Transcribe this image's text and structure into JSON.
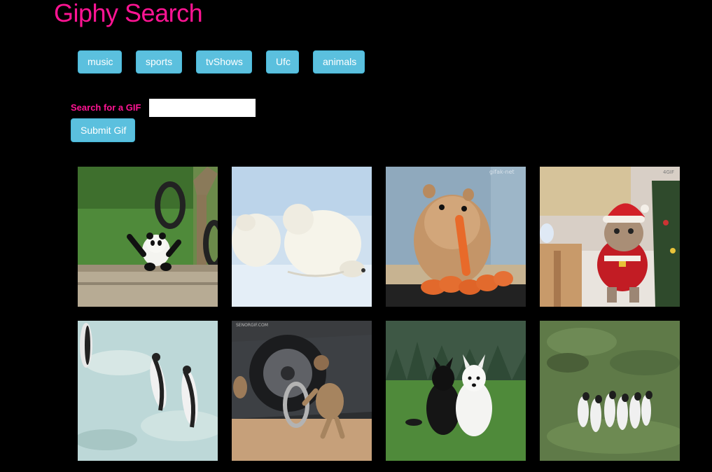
{
  "header": {
    "title": "Giphy Search"
  },
  "categories": [
    "music",
    "sports",
    "tvShows",
    "Ufc",
    "animals"
  ],
  "search": {
    "label": "Search for a GIF",
    "value": "",
    "submit_label": "Submit Gif"
  },
  "gifs": [
    {
      "depicts": "panda-on-log"
    },
    {
      "depicts": "polar-bears-in-snow"
    },
    {
      "depicts": "hamster-eating-carrots",
      "watermark": "gifak-net"
    },
    {
      "depicts": "cat-in-santa-suit",
      "watermark": "4GIF"
    },
    {
      "depicts": "penguins-sliding-on-snow"
    },
    {
      "depicts": "monkey-taking-car-wheel",
      "watermark": "SENORGIF.COM"
    },
    {
      "depicts": "two-dogs-sitting-on-grass"
    },
    {
      "depicts": "penguins-running-on-grass"
    }
  ],
  "colors": {
    "background": "#000000",
    "title": "#ff1493",
    "label": "#ff1493",
    "button": "#5bc0de",
    "button_text": "#ffffff"
  }
}
